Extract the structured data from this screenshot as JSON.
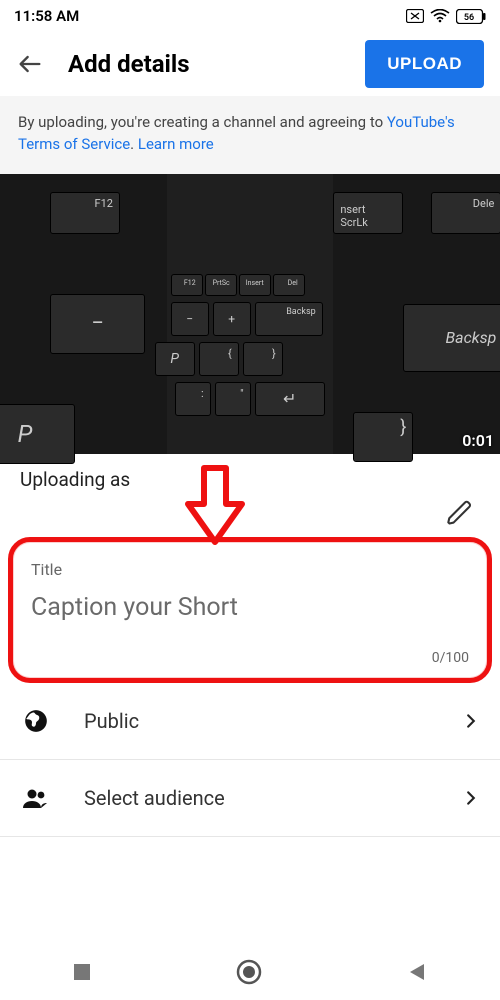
{
  "status": {
    "time": "11:58 AM",
    "battery": "56"
  },
  "appbar": {
    "title": "Add details",
    "upload": "UPLOAD"
  },
  "notice": {
    "prefix": "By uploading, you're creating a channel and agreeing to ",
    "link1": "YouTube's Terms of Service",
    "sep": ". ",
    "link2": "Learn more"
  },
  "preview": {
    "timecode": "0:01",
    "keys": {
      "f12": "F12",
      "insert": "nsert",
      "scrlk": "ScrLk",
      "del": "Dele",
      "backsp_small": "Backsp",
      "backsp": "Backsp",
      "p": "P"
    }
  },
  "uploading_as": "Uploading as",
  "title_card": {
    "label": "Title",
    "placeholder": "Caption your Short",
    "counter": "0/100"
  },
  "rows": {
    "visibility": "Public",
    "audience": "Select audience"
  }
}
